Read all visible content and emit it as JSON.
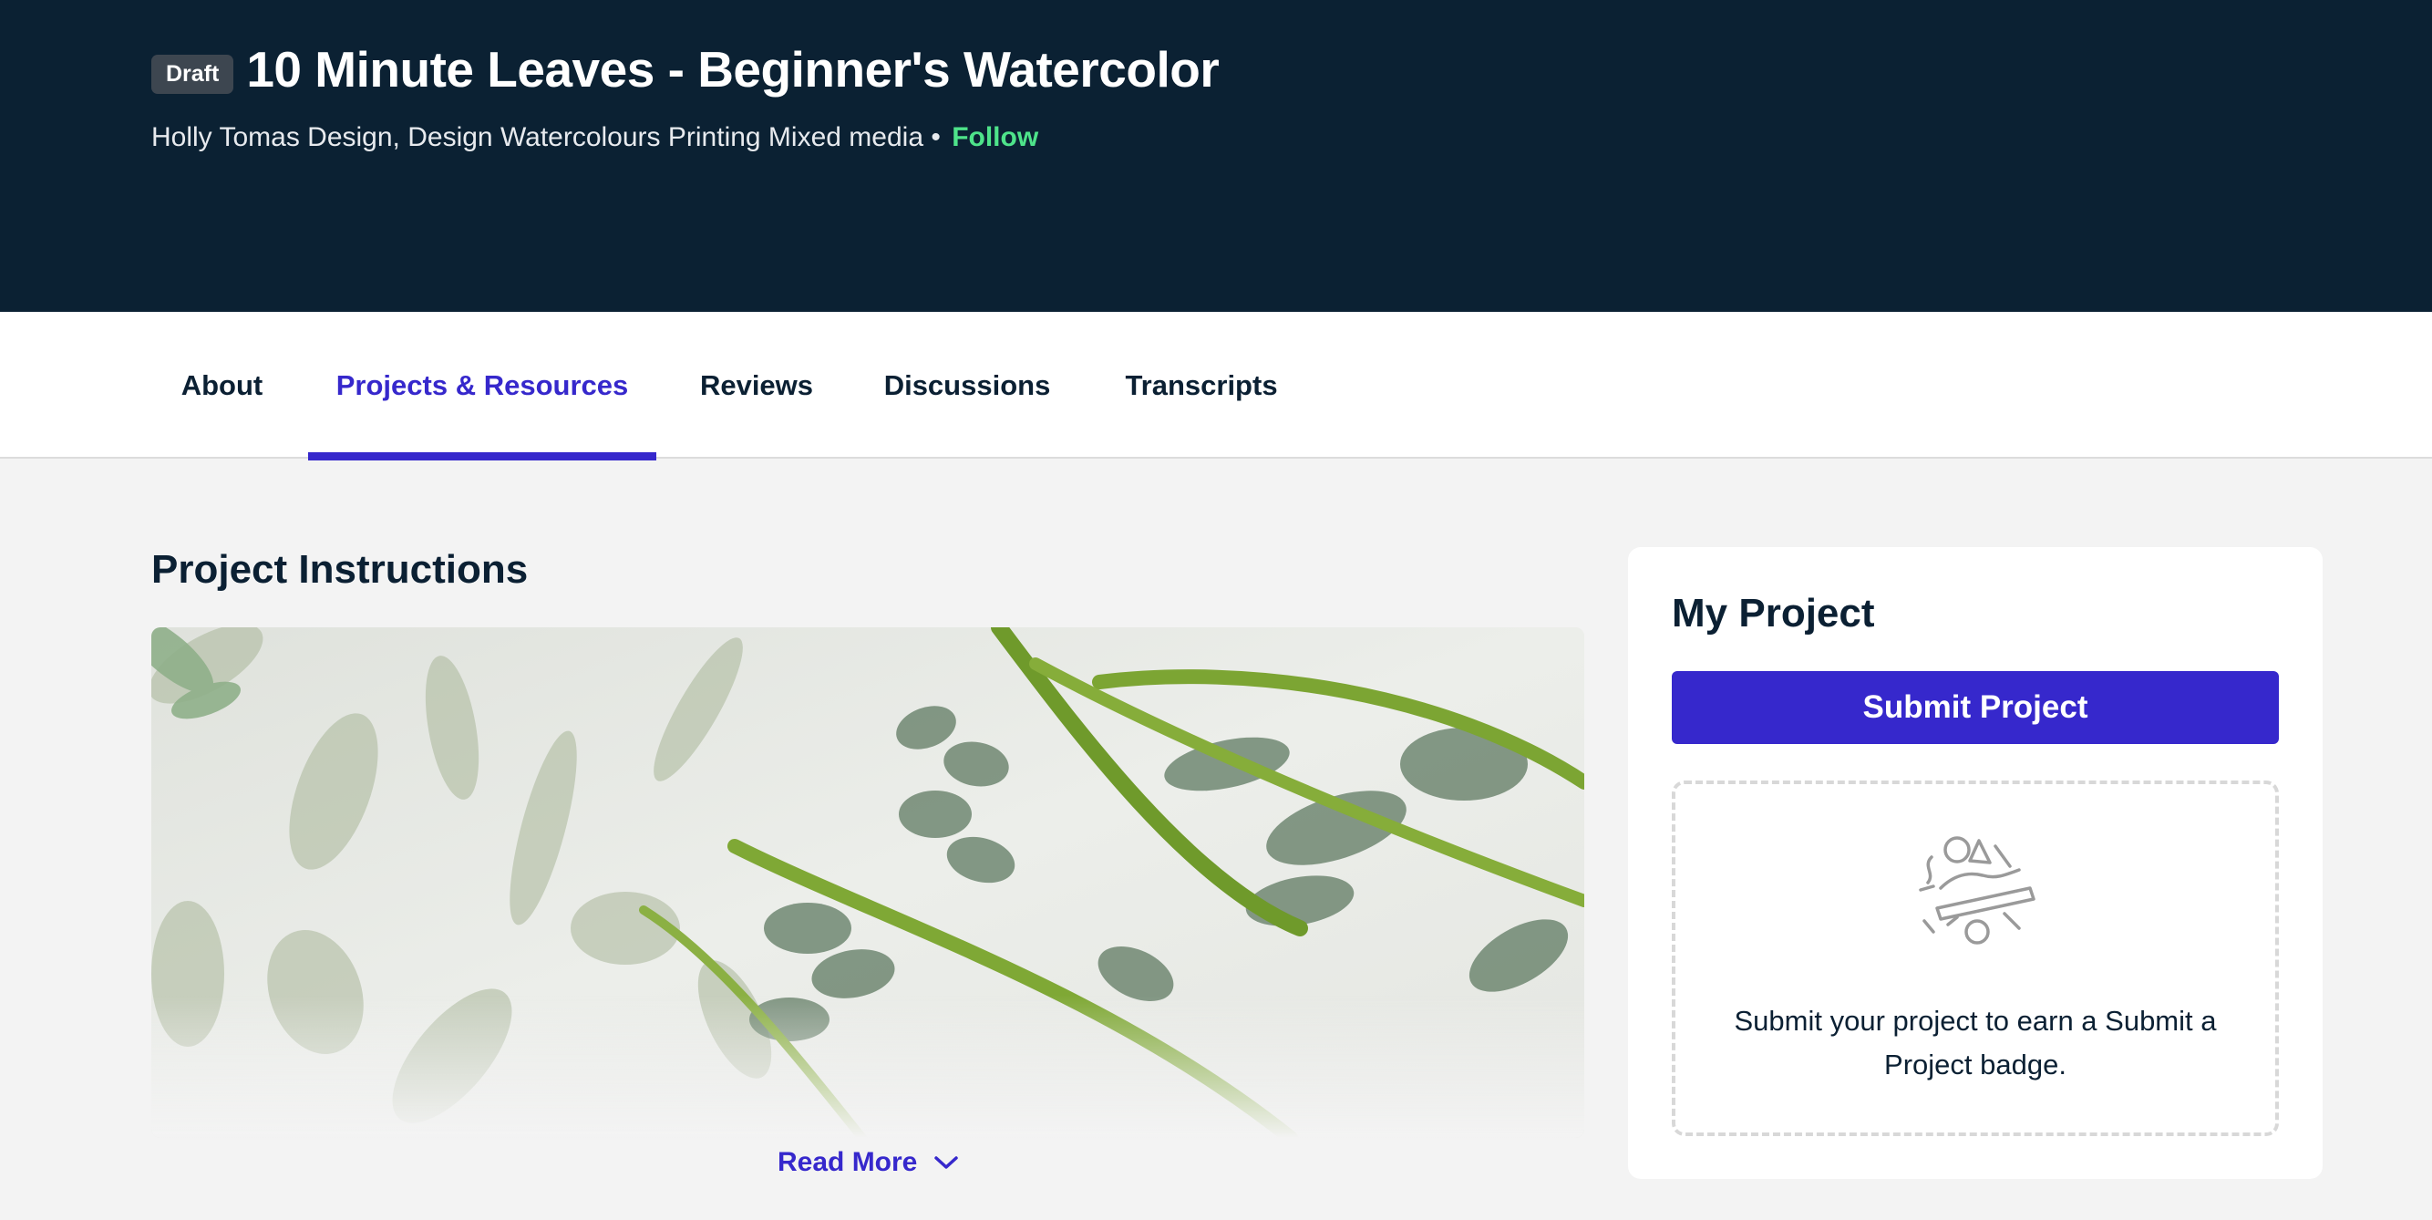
{
  "header": {
    "badge": "Draft",
    "title": "10 Minute Leaves - Beginner's Watercolor",
    "author_line": "Holly Tomas Design, Design Watercolours Printing Mixed media •",
    "follow_label": "Follow"
  },
  "tabs": [
    {
      "label": "About",
      "active": false
    },
    {
      "label": "Projects & Resources",
      "active": true
    },
    {
      "label": "Reviews",
      "active": false
    },
    {
      "label": "Discussions",
      "active": false
    },
    {
      "label": "Transcripts",
      "active": false
    }
  ],
  "main": {
    "section_title": "Project Instructions",
    "read_more_label": "Read More"
  },
  "sidebar": {
    "card_title": "My Project",
    "submit_label": "Submit Project",
    "dropzone_text": "Submit your project to earn a Submit a Project badge."
  },
  "colors": {
    "header_bg": "#0b2133",
    "accent": "#3628cc",
    "follow": "#4ee38a",
    "page_bg": "#f3f3f3"
  },
  "icons": {
    "read_more": "chevron-down-icon",
    "dropzone": "project-badge-icon"
  }
}
